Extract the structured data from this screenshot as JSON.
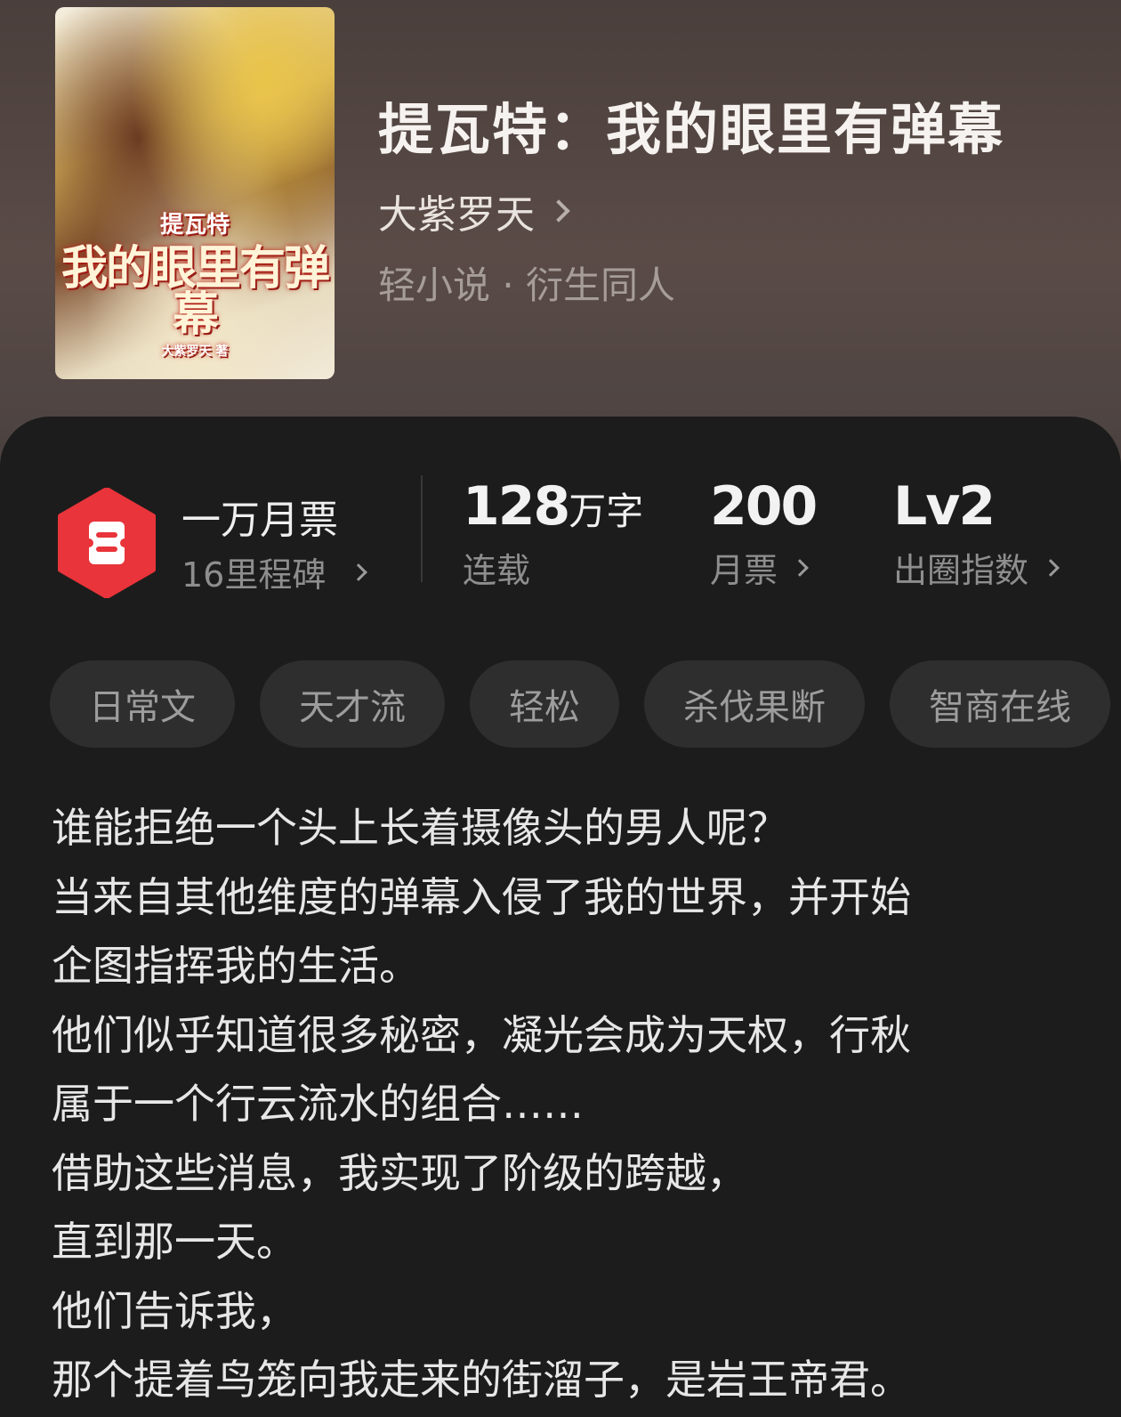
{
  "book": {
    "title": "提瓦特：我的眼里有弹幕",
    "author": "大紫罗天",
    "genre": "轻小说 · 衍生同人",
    "cover": {
      "series": "提瓦特",
      "title_art": "我的眼里有弹幕",
      "author_credit": "大紫罗天 著"
    }
  },
  "stats": {
    "milestone_top": "一万月票",
    "milestone_bottom": "16里程碑",
    "words_number": "128",
    "words_unit": "万字",
    "words_label": "连载",
    "votes_number": "200",
    "votes_label": "月票",
    "level_number": "Lv2",
    "level_label": "出圈指数"
  },
  "tags": [
    "日常文",
    "天才流",
    "轻松",
    "杀伐果断",
    "智商在线"
  ],
  "synopsis": [
    "谁能拒绝一个头上长着摄像头的男人呢？",
    "当来自其他维度的弹幕入侵了我的世界，并开始",
    "企图指挥我的生活。",
    "他们似乎知道很多秘密，凝光会成为天权，行秋",
    "属于一个行云流水的组合……",
    "借助这些消息，我实现了阶级的跨越，",
    "直到那一天。",
    "他们告诉我，",
    "那个提着鸟笼向我走来的街溜子，是岩王帝君。"
  ],
  "colors": {
    "badge_red": "#e8343a",
    "sheet_bg": "#1c1c1c",
    "tag_bg": "#2e2e2e"
  }
}
